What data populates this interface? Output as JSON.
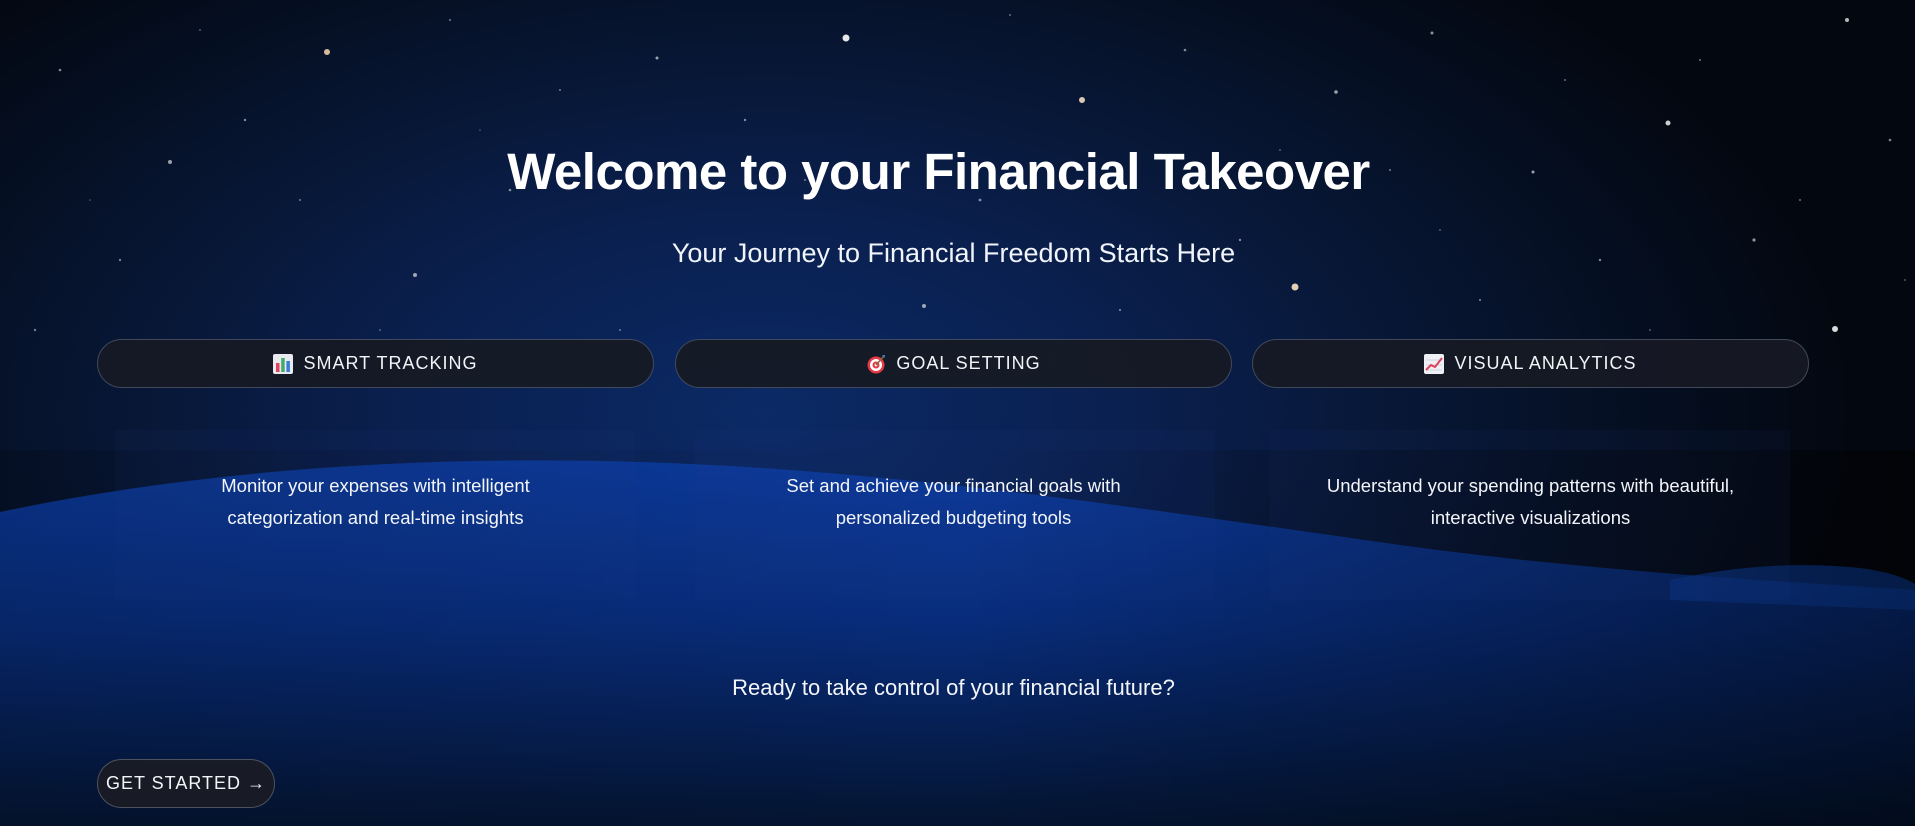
{
  "hero": {
    "title": "Welcome to your Financial Takeover",
    "subtitle": "Your Journey to Financial Freedom Starts Here"
  },
  "features": [
    {
      "label": "SMART TRACKING",
      "icon": "bar-chart-icon",
      "description_line1": "Monitor your expenses with intelligent",
      "description_line2": "categorization and real-time insights"
    },
    {
      "label": "GOAL SETTING",
      "icon": "target-icon",
      "description_line1": "Set and achieve your financial goals with",
      "description_line2": "personalized budgeting tools"
    },
    {
      "label": "VISUAL ANALYTICS",
      "icon": "chart-increasing-icon",
      "description_line1": "Understand your spending patterns with beautiful,",
      "description_line2": "interactive visualizations"
    }
  ],
  "cta": {
    "prompt": "Ready to take control of your financial future?",
    "button_label": "GET STARTED →"
  },
  "colors": {
    "background": "#050a18",
    "hill": "#0a3a9a",
    "button_bg": "#161924",
    "text": "#ffffff"
  }
}
